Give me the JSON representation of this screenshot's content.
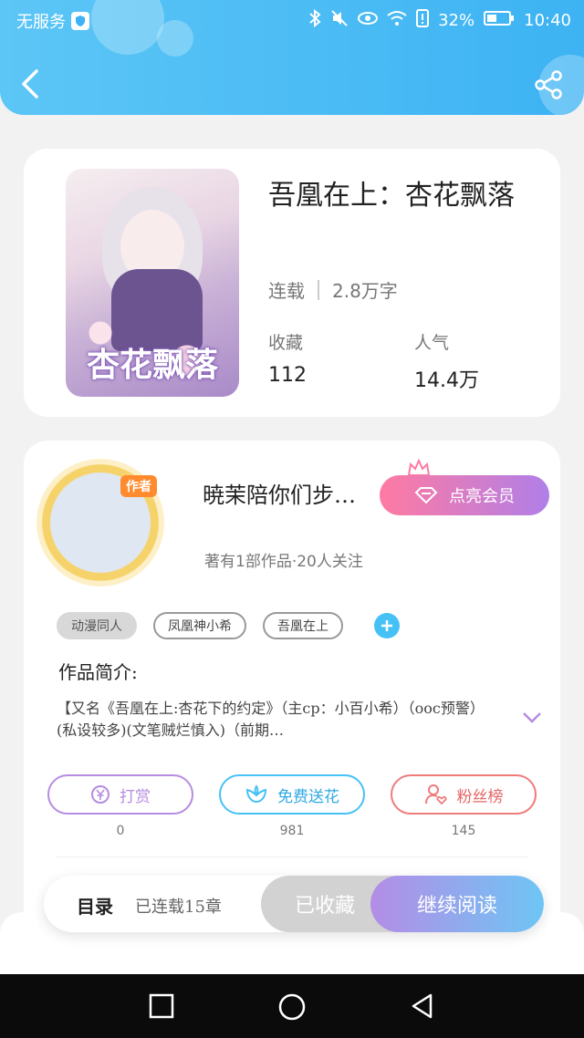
{
  "status_bar": {
    "carrier": "无服务",
    "battery": "32%",
    "time": "10:40"
  },
  "header": {
    "back_icon": "chevron-left-icon",
    "share_icon": "share-icon"
  },
  "book": {
    "cover_text": "杏花飘落",
    "title": "吾凰在上：杏花飘落",
    "status": "连载",
    "word_count": "2.8万字",
    "collect_label": "收藏",
    "collect_value": "112",
    "popularity_label": "人气",
    "popularity_value": "14.4万"
  },
  "author": {
    "avatar_tag": "作者",
    "name": "暁茉陪你们步…",
    "info": "著有1部作品·20人关注",
    "vip_label": "点亮会员"
  },
  "tags": [
    "动漫同人",
    "凤凰神小希",
    "吾凰在上"
  ],
  "intro": {
    "label": "作品简介:",
    "text": "【又名《吾凰在上:杏花下的约定》（主cp：小百小希）（ooc预警）(私设较多)(文笔贼烂慎入)（前期…"
  },
  "actions": {
    "reward_label": "打赏",
    "reward_count": "0",
    "flower_label": "免费送花",
    "flower_count": "981",
    "fans_label": "粉丝榜",
    "fans_count": "145"
  },
  "bottom_bar": {
    "toc_label": "目录",
    "chapters": "已连载15章",
    "collected_label": "已收藏",
    "continue_label": "继续阅读"
  },
  "colors": {
    "header_blue": "#3db3f3",
    "vip_pink": "#ff7aa2",
    "flower_teal": "#46c1f6",
    "reward_purple": "#b58ce0",
    "fans_red": "#ef7b7b"
  }
}
